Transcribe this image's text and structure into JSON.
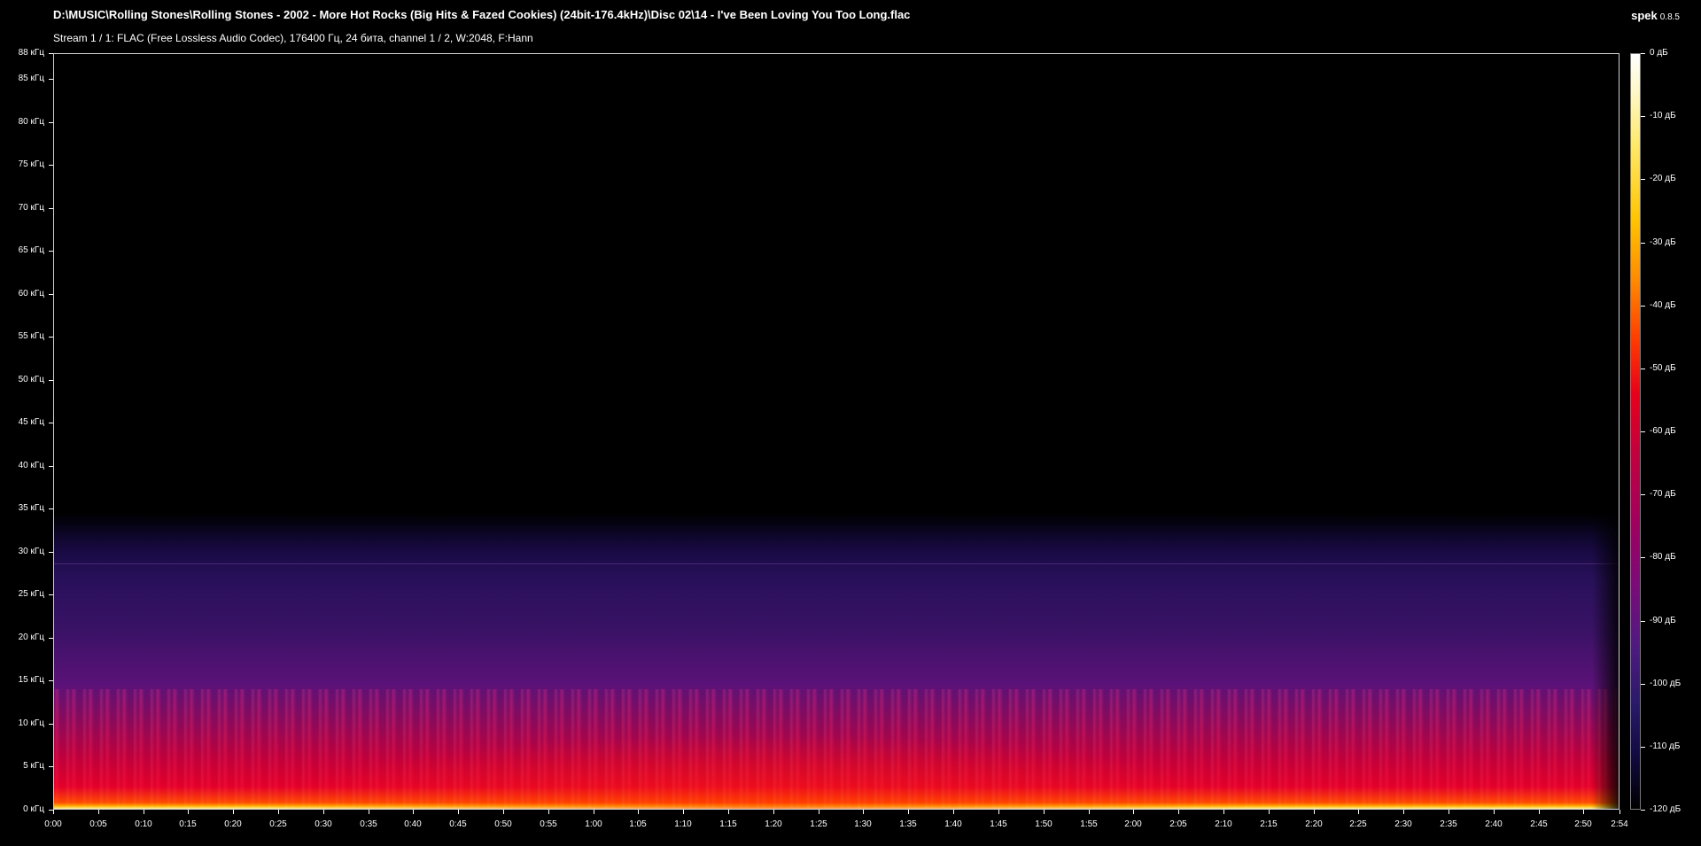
{
  "window": {
    "title": "D:\\MUSIC\\Rolling Stones\\Rolling Stones - 2002 - More Hot Rocks (Big Hits & Fazed Cookies) (24bit-176.4kHz)\\Disc 02\\14 - I've Been Loving You Too Long.flac",
    "subtitle": "Stream 1 / 1: FLAC (Free Lossless Audio Codec), 176400 Гц, 24 бита, channel 1 / 2, W:2048, F:Hann",
    "app_name": "spek",
    "app_version": "0.8.5"
  },
  "spectrogram": {
    "frequency_axis": [
      "88 кГц",
      "85 кГц",
      "80 кГц",
      "75 кГц",
      "70 кГц",
      "65 кГц",
      "60 кГц",
      "55 кГц",
      "50 кГц",
      "45 кГц",
      "40 кГц",
      "35 кГц",
      "30 кГц",
      "25 кГц",
      "20 кГц",
      "15 кГц",
      "10 кГц",
      "5 кГц",
      "0 кГц"
    ],
    "time_axis": [
      "0:00",
      "0:05",
      "0:10",
      "0:15",
      "0:20",
      "0:25",
      "0:30",
      "0:35",
      "0:40",
      "0:45",
      "0:50",
      "0:55",
      "1:00",
      "1:05",
      "1:10",
      "1:15",
      "1:20",
      "1:25",
      "1:30",
      "1:35",
      "1:40",
      "1:45",
      "1:50",
      "1:55",
      "2:00",
      "2:05",
      "2:10",
      "2:15",
      "2:20",
      "2:25",
      "2:30",
      "2:35",
      "2:40",
      "2:45",
      "2:50",
      "2:54"
    ],
    "db_scale": [
      "0 дБ",
      "-10 дБ",
      "-20 дБ",
      "-30 дБ",
      "-40 дБ",
      "-50 дБ",
      "-60 дБ",
      "-70 дБ",
      "-80 дБ",
      "-90 дБ",
      "-100 дБ",
      "-110 дБ",
      "-120 дБ"
    ],
    "palette": {
      "background": "#000000",
      "low": "#28105a",
      "mid": "#e3002a",
      "high": "#ffb000",
      "peak": "#ffffff"
    }
  }
}
